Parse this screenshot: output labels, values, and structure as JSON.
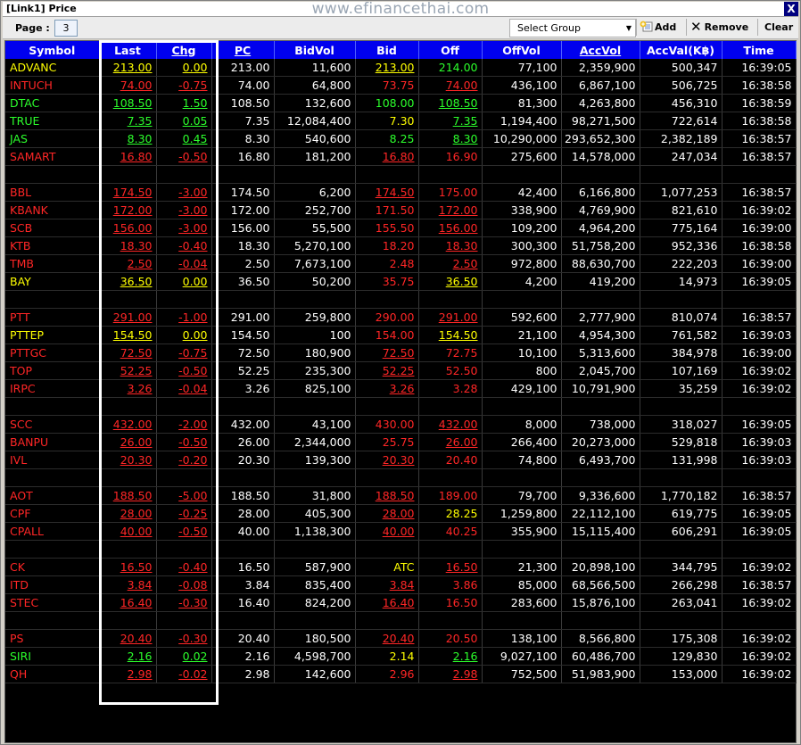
{
  "window": {
    "title": "[Link1] Price",
    "watermark": "www.efinancethai.com",
    "close_label": "X"
  },
  "toolbar": {
    "page_label": "Page :",
    "page_value": "3",
    "select_group": "Select Group",
    "add_label": "Add",
    "remove_label": "Remove",
    "clear_label": "Clear"
  },
  "colors": {
    "header_bg": "#0000ee",
    "grid_bg": "#000000",
    "up": "#2cff2c",
    "down": "#ff2626",
    "unchanged": "#ffff00",
    "neutral": "#ffffff"
  },
  "columns": [
    "Symbol",
    "Last",
    "Chg",
    "PC",
    "BidVol",
    "Bid",
    "Off",
    "OffVol",
    "AccVol",
    "AccVal(K฿)",
    "Time"
  ],
  "rows": [
    {
      "c": "y",
      "v": [
        "ADVANC",
        "213.00",
        "0.00",
        "213.00",
        "11,600",
        "213.00",
        "214.00",
        "77,100",
        "2,359,900",
        "500,347",
        "16:39:05"
      ],
      "bc": "y",
      "oc": "g",
      "bu": true,
      "ou": false
    },
    {
      "c": "r",
      "v": [
        "INTUCH",
        "74.00",
        "-0.75",
        "74.00",
        "64,800",
        "73.75",
        "74.00",
        "436,100",
        "6,867,100",
        "506,725",
        "16:38:58"
      ],
      "bc": "r",
      "oc": "r",
      "bu": false,
      "ou": true
    },
    {
      "c": "g",
      "v": [
        "DTAC",
        "108.50",
        "1.50",
        "108.50",
        "132,600",
        "108.00",
        "108.50",
        "81,300",
        "4,263,800",
        "456,310",
        "16:38:59"
      ],
      "bc": "g",
      "oc": "g",
      "bu": false,
      "ou": true
    },
    {
      "c": "g",
      "v": [
        "TRUE",
        "7.35",
        "0.05",
        "7.35",
        "12,084,400",
        "7.30",
        "7.35",
        "1,194,400",
        "98,271,500",
        "722,614",
        "16:38:58"
      ],
      "bc": "y",
      "oc": "g",
      "bu": false,
      "ou": true
    },
    {
      "c": "g",
      "v": [
        "JAS",
        "8.30",
        "0.45",
        "8.30",
        "540,600",
        "8.25",
        "8.30",
        "10,290,000",
        "293,652,300",
        "2,382,189",
        "16:38:57"
      ],
      "bc": "g",
      "oc": "g",
      "bu": false,
      "ou": true
    },
    {
      "c": "r",
      "v": [
        "SAMART",
        "16.80",
        "-0.50",
        "16.80",
        "181,200",
        "16.80",
        "16.90",
        "275,600",
        "14,578,000",
        "247,034",
        "16:38:57"
      ],
      "bc": "r",
      "oc": "r",
      "bu": true,
      "ou": false
    },
    {
      "blank": true
    },
    {
      "c": "r",
      "v": [
        "BBL",
        "174.50",
        "-3.00",
        "174.50",
        "6,200",
        "174.50",
        "175.00",
        "42,400",
        "6,166,800",
        "1,077,253",
        "16:38:57"
      ],
      "bc": "r",
      "oc": "r",
      "bu": true,
      "ou": false
    },
    {
      "c": "r",
      "v": [
        "KBANK",
        "172.00",
        "-3.00",
        "172.00",
        "252,700",
        "171.50",
        "172.00",
        "338,900",
        "4,769,900",
        "821,610",
        "16:39:02"
      ],
      "bc": "r",
      "oc": "r",
      "bu": false,
      "ou": true
    },
    {
      "c": "r",
      "v": [
        "SCB",
        "156.00",
        "-3.00",
        "156.00",
        "55,500",
        "155.50",
        "156.00",
        "109,200",
        "4,964,200",
        "775,164",
        "16:39:00"
      ],
      "bc": "r",
      "oc": "r",
      "bu": false,
      "ou": true
    },
    {
      "c": "r",
      "v": [
        "KTB",
        "18.30",
        "-0.40",
        "18.30",
        "5,270,100",
        "18.20",
        "18.30",
        "300,300",
        "51,758,200",
        "952,336",
        "16:38:58"
      ],
      "bc": "r",
      "oc": "r",
      "bu": false,
      "ou": true
    },
    {
      "c": "r",
      "v": [
        "TMB",
        "2.50",
        "-0.04",
        "2.50",
        "7,673,100",
        "2.48",
        "2.50",
        "972,800",
        "88,630,700",
        "222,203",
        "16:39:00"
      ],
      "bc": "r",
      "oc": "r",
      "bu": false,
      "ou": true
    },
    {
      "c": "y",
      "v": [
        "BAY",
        "36.50",
        "0.00",
        "36.50",
        "50,200",
        "35.75",
        "36.50",
        "4,200",
        "419,200",
        "14,973",
        "16:39:05"
      ],
      "bc": "r",
      "oc": "y",
      "bu": false,
      "ou": true
    },
    {
      "blank": true
    },
    {
      "c": "r",
      "v": [
        "PTT",
        "291.00",
        "-1.00",
        "291.00",
        "259,800",
        "290.00",
        "291.00",
        "592,600",
        "2,777,900",
        "810,074",
        "16:38:57"
      ],
      "bc": "r",
      "oc": "r",
      "bu": false,
      "ou": true
    },
    {
      "c": "y",
      "v": [
        "PTTEP",
        "154.50",
        "0.00",
        "154.50",
        "100",
        "154.00",
        "154.50",
        "21,100",
        "4,954,300",
        "761,582",
        "16:39:03"
      ],
      "bc": "r",
      "oc": "y",
      "bu": false,
      "ou": true
    },
    {
      "c": "r",
      "v": [
        "PTTGC",
        "72.50",
        "-0.75",
        "72.50",
        "180,900",
        "72.50",
        "72.75",
        "10,100",
        "5,313,600",
        "384,978",
        "16:39:00"
      ],
      "bc": "r",
      "oc": "r",
      "bu": true,
      "ou": false
    },
    {
      "c": "r",
      "v": [
        "TOP",
        "52.25",
        "-0.50",
        "52.25",
        "235,300",
        "52.25",
        "52.50",
        "800",
        "2,045,700",
        "107,169",
        "16:39:02"
      ],
      "bc": "r",
      "oc": "r",
      "bu": true,
      "ou": false
    },
    {
      "c": "r",
      "v": [
        "IRPC",
        "3.26",
        "-0.04",
        "3.26",
        "825,100",
        "3.26",
        "3.28",
        "429,100",
        "10,791,900",
        "35,259",
        "16:39:02"
      ],
      "bc": "r",
      "oc": "r",
      "bu": true,
      "ou": false
    },
    {
      "blank": true
    },
    {
      "c": "r",
      "v": [
        "SCC",
        "432.00",
        "-2.00",
        "432.00",
        "43,100",
        "430.00",
        "432.00",
        "8,000",
        "738,000",
        "318,027",
        "16:39:05"
      ],
      "bc": "r",
      "oc": "r",
      "bu": false,
      "ou": true
    },
    {
      "c": "r",
      "v": [
        "BANPU",
        "26.00",
        "-0.50",
        "26.00",
        "2,344,000",
        "25.75",
        "26.00",
        "266,400",
        "20,273,000",
        "529,818",
        "16:39:03"
      ],
      "bc": "r",
      "oc": "r",
      "bu": false,
      "ou": true
    },
    {
      "c": "r",
      "v": [
        "IVL",
        "20.30",
        "-0.20",
        "20.30",
        "139,300",
        "20.30",
        "20.40",
        "74,800",
        "6,493,700",
        "131,998",
        "16:39:03"
      ],
      "bc": "r",
      "oc": "r",
      "bu": true,
      "ou": false
    },
    {
      "blank": true
    },
    {
      "c": "r",
      "v": [
        "AOT",
        "188.50",
        "-5.00",
        "188.50",
        "31,800",
        "188.50",
        "189.00",
        "79,700",
        "9,336,600",
        "1,770,182",
        "16:38:57"
      ],
      "bc": "r",
      "oc": "r",
      "bu": true,
      "ou": false
    },
    {
      "c": "r",
      "v": [
        "CPF",
        "28.00",
        "-0.25",
        "28.00",
        "405,300",
        "28.00",
        "28.25",
        "1,259,800",
        "22,112,100",
        "619,775",
        "16:39:05"
      ],
      "bc": "r",
      "oc": "y",
      "bu": true,
      "ou": false
    },
    {
      "c": "r",
      "v": [
        "CPALL",
        "40.00",
        "-0.50",
        "40.00",
        "1,138,300",
        "40.00",
        "40.25",
        "355,900",
        "15,115,400",
        "606,291",
        "16:39:05"
      ],
      "bc": "r",
      "oc": "r",
      "bu": true,
      "ou": false
    },
    {
      "blank": true
    },
    {
      "c": "r",
      "v": [
        "CK",
        "16.50",
        "-0.40",
        "16.50",
        "587,900",
        "ATC",
        "16.50",
        "21,300",
        "20,898,100",
        "344,795",
        "16:39:02"
      ],
      "bc": "y",
      "oc": "r",
      "bu": false,
      "ou": true
    },
    {
      "c": "r",
      "v": [
        "ITD",
        "3.84",
        "-0.08",
        "3.84",
        "835,400",
        "3.84",
        "3.86",
        "85,000",
        "68,566,500",
        "266,298",
        "16:38:57"
      ],
      "bc": "r",
      "oc": "r",
      "bu": true,
      "ou": false
    },
    {
      "c": "r",
      "v": [
        "STEC",
        "16.40",
        "-0.30",
        "16.40",
        "824,200",
        "16.40",
        "16.50",
        "283,600",
        "15,876,100",
        "263,041",
        "16:39:02"
      ],
      "bc": "r",
      "oc": "r",
      "bu": true,
      "ou": false
    },
    {
      "blank": true
    },
    {
      "c": "r",
      "v": [
        "PS",
        "20.40",
        "-0.30",
        "20.40",
        "180,500",
        "20.40",
        "20.50",
        "138,100",
        "8,566,800",
        "175,308",
        "16:39:02"
      ],
      "bc": "r",
      "oc": "r",
      "bu": true,
      "ou": false
    },
    {
      "c": "g",
      "v": [
        "SIRI",
        "2.16",
        "0.02",
        "2.16",
        "4,598,700",
        "2.14",
        "2.16",
        "9,027,100",
        "60,486,700",
        "129,830",
        "16:39:02"
      ],
      "bc": "y",
      "oc": "g",
      "bu": false,
      "ou": true
    },
    {
      "c": "r",
      "v": [
        "QH",
        "2.98",
        "-0.02",
        "2.98",
        "142,600",
        "2.96",
        "2.98",
        "752,500",
        "51,983,900",
        "153,000",
        "16:39:02"
      ],
      "bc": "r",
      "oc": "r",
      "bu": false,
      "ou": true
    }
  ]
}
